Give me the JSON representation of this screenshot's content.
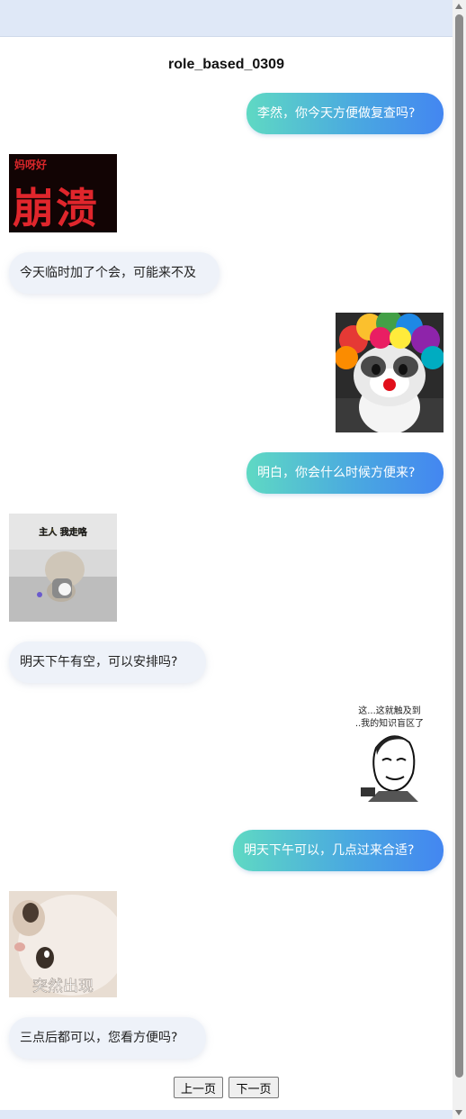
{
  "title": "role_based_0309",
  "messages": [
    {
      "type": "text",
      "side": "out",
      "text": "李然，你今天方便做复查吗?"
    },
    {
      "type": "sticker",
      "side": "in",
      "name": "sticker-bengkui",
      "caption_top": "妈呀好",
      "caption_main": "崩溃"
    },
    {
      "type": "text",
      "side": "in",
      "text": "今天临时加了个会，可能来不及"
    },
    {
      "type": "sticker",
      "side": "out",
      "name": "sticker-clown-cat"
    },
    {
      "type": "text",
      "side": "out",
      "text": "明白，你会什么时候方便来?"
    },
    {
      "type": "sticker",
      "side": "in",
      "name": "sticker-cat-walking",
      "caption": "主人 我走咯"
    },
    {
      "type": "text",
      "side": "in",
      "text": "明天下午有空，可以安排吗?"
    },
    {
      "type": "sticker",
      "side": "out",
      "name": "sticker-knowledge-blind-spot",
      "caption_line1": "这...这就触及到",
      "caption_line2": "..我的知识盲区了"
    },
    {
      "type": "text",
      "side": "out",
      "text": "明天下午可以，几点过来合适?"
    },
    {
      "type": "sticker",
      "side": "in",
      "name": "sticker-cat-peek",
      "caption": "突然出现"
    },
    {
      "type": "text",
      "side": "in",
      "text": "三点后都可以，您看方便吗?"
    }
  ],
  "pagination": {
    "prev_label": "上一页",
    "next_label": "下一页"
  },
  "colors": {
    "outgoing_start": "#5fd9c3",
    "outgoing_end": "#4386f1",
    "incoming_bg": "#eef2f9"
  }
}
